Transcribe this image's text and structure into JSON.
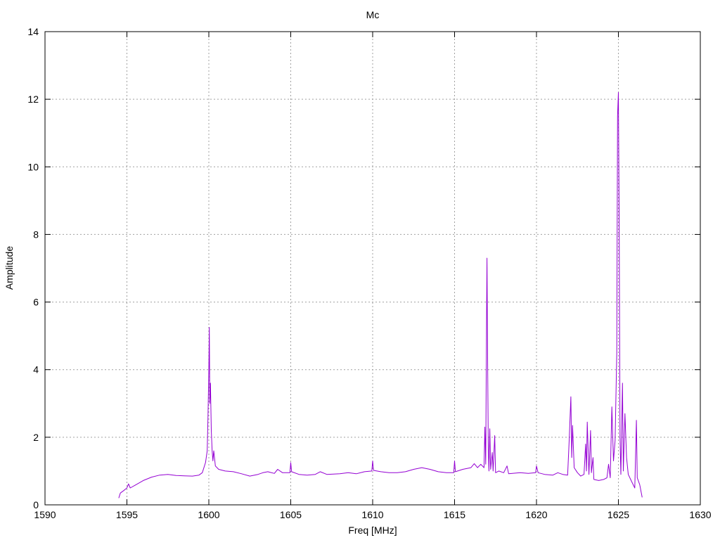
{
  "chart_data": {
    "type": "line",
    "title": "Mc",
    "xlabel": "Freq [MHz]",
    "ylabel": "Amplitude",
    "xlim": [
      1590,
      1630
    ],
    "ylim": [
      0,
      14
    ],
    "xticks": [
      1590,
      1595,
      1600,
      1605,
      1610,
      1615,
      1620,
      1625,
      1630
    ],
    "yticks": [
      0,
      2,
      4,
      6,
      8,
      10,
      12,
      14
    ],
    "grid": true,
    "series_color": "#9400d3",
    "series": [
      {
        "points": [
          [
            1594.5,
            0.2
          ],
          [
            1594.6,
            0.35
          ],
          [
            1594.8,
            0.42
          ],
          [
            1595.0,
            0.5
          ],
          [
            1595.1,
            0.62
          ],
          [
            1595.2,
            0.5
          ],
          [
            1595.5,
            0.58
          ],
          [
            1596.0,
            0.72
          ],
          [
            1596.5,
            0.82
          ],
          [
            1597.0,
            0.88
          ],
          [
            1597.5,
            0.9
          ],
          [
            1598.0,
            0.87
          ],
          [
            1598.5,
            0.86
          ],
          [
            1599.0,
            0.85
          ],
          [
            1599.4,
            0.88
          ],
          [
            1599.6,
            0.95
          ],
          [
            1599.8,
            1.25
          ],
          [
            1599.9,
            1.6
          ],
          [
            1599.95,
            2.6
          ],
          [
            1600.0,
            4.0
          ],
          [
            1600.03,
            5.25
          ],
          [
            1600.06,
            3.0
          ],
          [
            1600.1,
            3.6
          ],
          [
            1600.15,
            2.2
          ],
          [
            1600.2,
            1.6
          ],
          [
            1600.25,
            1.3
          ],
          [
            1600.3,
            1.6
          ],
          [
            1600.4,
            1.15
          ],
          [
            1600.6,
            1.05
          ],
          [
            1601.0,
            1.0
          ],
          [
            1601.5,
            0.98
          ],
          [
            1602.0,
            0.92
          ],
          [
            1602.5,
            0.85
          ],
          [
            1603.0,
            0.9
          ],
          [
            1603.3,
            0.95
          ],
          [
            1603.6,
            0.98
          ],
          [
            1604.0,
            0.93
          ],
          [
            1604.2,
            1.05
          ],
          [
            1604.5,
            0.95
          ],
          [
            1604.95,
            0.95
          ],
          [
            1605.0,
            1.25
          ],
          [
            1605.05,
            0.98
          ],
          [
            1605.5,
            0.9
          ],
          [
            1606.0,
            0.88
          ],
          [
            1606.5,
            0.9
          ],
          [
            1606.8,
            0.98
          ],
          [
            1607.2,
            0.9
          ],
          [
            1608.0,
            0.92
          ],
          [
            1608.5,
            0.95
          ],
          [
            1609.0,
            0.92
          ],
          [
            1609.5,
            0.98
          ],
          [
            1609.95,
            1.0
          ],
          [
            1610.0,
            1.3
          ],
          [
            1610.05,
            1.02
          ],
          [
            1610.5,
            0.98
          ],
          [
            1611.0,
            0.95
          ],
          [
            1611.5,
            0.95
          ],
          [
            1612.0,
            0.98
          ],
          [
            1612.5,
            1.05
          ],
          [
            1613.0,
            1.1
          ],
          [
            1613.5,
            1.05
          ],
          [
            1614.0,
            0.98
          ],
          [
            1614.5,
            0.95
          ],
          [
            1614.95,
            0.95
          ],
          [
            1615.0,
            1.3
          ],
          [
            1615.05,
            0.98
          ],
          [
            1615.5,
            1.05
          ],
          [
            1616.0,
            1.1
          ],
          [
            1616.2,
            1.22
          ],
          [
            1616.4,
            1.1
          ],
          [
            1616.6,
            1.2
          ],
          [
            1616.8,
            1.1
          ],
          [
            1616.85,
            2.3
          ],
          [
            1616.9,
            1.2
          ],
          [
            1616.95,
            5.2
          ],
          [
            1616.98,
            7.3
          ],
          [
            1617.02,
            4.0
          ],
          [
            1617.06,
            1.6
          ],
          [
            1617.1,
            1.0
          ],
          [
            1617.15,
            2.25
          ],
          [
            1617.2,
            1.05
          ],
          [
            1617.3,
            1.55
          ],
          [
            1617.35,
            1.0
          ],
          [
            1617.45,
            2.05
          ],
          [
            1617.5,
            0.95
          ],
          [
            1617.7,
            1.0
          ],
          [
            1618.0,
            0.95
          ],
          [
            1618.2,
            1.15
          ],
          [
            1618.3,
            0.92
          ],
          [
            1619.0,
            0.95
          ],
          [
            1619.5,
            0.93
          ],
          [
            1619.95,
            0.95
          ],
          [
            1620.0,
            1.15
          ],
          [
            1620.1,
            0.95
          ],
          [
            1620.5,
            0.9
          ],
          [
            1621.0,
            0.88
          ],
          [
            1621.3,
            0.95
          ],
          [
            1621.6,
            0.9
          ],
          [
            1621.9,
            0.88
          ],
          [
            1622.0,
            1.95
          ],
          [
            1622.1,
            3.2
          ],
          [
            1622.15,
            1.4
          ],
          [
            1622.2,
            2.35
          ],
          [
            1622.3,
            1.1
          ],
          [
            1622.5,
            0.95
          ],
          [
            1622.7,
            0.85
          ],
          [
            1622.9,
            0.9
          ],
          [
            1623.0,
            1.8
          ],
          [
            1623.05,
            1.0
          ],
          [
            1623.1,
            2.45
          ],
          [
            1623.2,
            0.9
          ],
          [
            1623.3,
            2.2
          ],
          [
            1623.35,
            0.95
          ],
          [
            1623.45,
            1.4
          ],
          [
            1623.5,
            0.75
          ],
          [
            1623.8,
            0.72
          ],
          [
            1624.1,
            0.75
          ],
          [
            1624.3,
            0.8
          ],
          [
            1624.4,
            1.2
          ],
          [
            1624.5,
            0.8
          ],
          [
            1624.6,
            2.9
          ],
          [
            1624.7,
            1.3
          ],
          [
            1624.8,
            1.9
          ],
          [
            1624.9,
            4.5
          ],
          [
            1624.95,
            11.5
          ],
          [
            1625.0,
            12.2
          ],
          [
            1625.05,
            8.0
          ],
          [
            1625.1,
            2.0
          ],
          [
            1625.15,
            0.9
          ],
          [
            1625.25,
            3.6
          ],
          [
            1625.3,
            1.0
          ],
          [
            1625.4,
            2.7
          ],
          [
            1625.5,
            1.4
          ],
          [
            1625.6,
            0.9
          ],
          [
            1625.8,
            0.7
          ],
          [
            1626.0,
            0.5
          ],
          [
            1626.1,
            2.5
          ],
          [
            1626.15,
            0.8
          ],
          [
            1626.3,
            0.6
          ],
          [
            1626.45,
            0.22
          ]
        ]
      }
    ]
  }
}
